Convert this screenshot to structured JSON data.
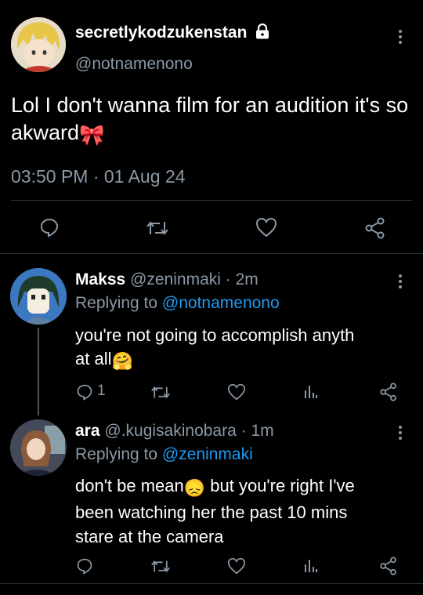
{
  "main_tweet": {
    "display_name": "secretlykodzukenstan",
    "handle": "@notnamenono",
    "text": "Lol I don't wanna film for an audition it's so akward",
    "emoji": "🎀",
    "timestamp": "03:50 PM · 01 Aug 24",
    "locked": true,
    "actions": [
      "reply-icon",
      "retweet-icon",
      "like-icon",
      "share-icon"
    ]
  },
  "replies": [
    {
      "display_name": "Makss",
      "handle": "@zeninmaki",
      "time": "· 2m",
      "replying_to_prefix": "Replying to",
      "replying_to": "@notnamenono",
      "text_line1": "you're not going to accomplish anyth",
      "text_line2": "at all",
      "emoji": "🤗",
      "reply_count": "1"
    },
    {
      "display_name": "ara",
      "handle": "@.kugisakinobara",
      "time": "· 1m",
      "replying_to_prefix": "Replying to",
      "replying_to": "@zeninmaki",
      "text_line1a": "don't be mean",
      "emoji": "😞",
      "text_line1b": " but you're right I've",
      "text_line2": "been watching her the past 10 mins",
      "text_line3": "stare at the camera"
    }
  ],
  "colors": {
    "background": "#000000",
    "text": "#ffffff",
    "muted": "#8b98a5",
    "link": "#1d9bf0"
  }
}
